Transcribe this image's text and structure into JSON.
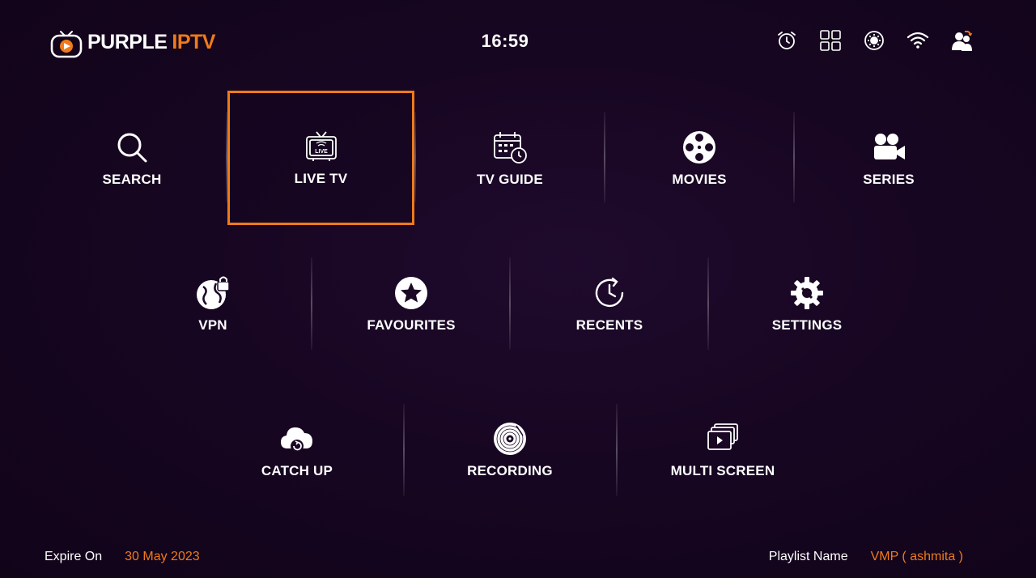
{
  "app": {
    "logo_word_1": "PURPLE",
    "logo_word_2": "IPTV",
    "clock": "16:59",
    "accent_color": "#f07a1a"
  },
  "header_icons": [
    {
      "name": "alarm-icon"
    },
    {
      "name": "grid-icon"
    },
    {
      "name": "settings-refresh-icon"
    },
    {
      "name": "wifi-icon"
    },
    {
      "name": "switch-user-icon"
    }
  ],
  "menu": {
    "search": "SEARCH",
    "live_tv": "LIVE TV",
    "tv_guide": "TV GUIDE",
    "movies": "MOVIES",
    "series": "SERIES",
    "vpn": "VPN",
    "favourites": "FAVOURITES",
    "recents": "RECENTS",
    "settings": "SETTINGS",
    "catch_up": "CATCH UP",
    "recording": "RECORDING",
    "multi_screen": "MULTI SCREEN",
    "selected": "LIVE TV"
  },
  "footer": {
    "expire_label": "Expire On",
    "expire_value": "30 May 2023",
    "playlist_label": "Playlist Name",
    "playlist_value": "VMP ( ashmita )"
  }
}
